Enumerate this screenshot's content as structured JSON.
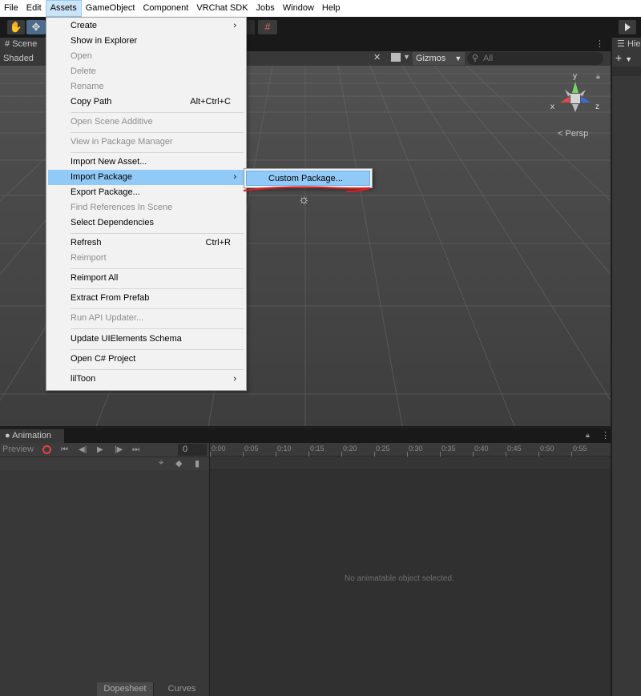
{
  "menubar": {
    "items": [
      "File",
      "Edit",
      "Assets",
      "GameObject",
      "Component",
      "VRChat SDK",
      "Jobs",
      "Window",
      "Help"
    ],
    "active_index": 2
  },
  "scene": {
    "tab_label": "Scene",
    "shading_mode": "Shaded",
    "gizmos_label": "Gizmos",
    "search_placeholder": "All",
    "persp_label": "< Persp",
    "axis_labels": {
      "y": "y",
      "x": "x",
      "z": "z"
    }
  },
  "hierarchy": {
    "tab_label": "Hie",
    "add_label": "+"
  },
  "assets_menu": {
    "items": [
      {
        "label": "Create",
        "shortcut": "",
        "disabled": false,
        "submenu": true
      },
      {
        "label": "Show in Explorer",
        "shortcut": "",
        "disabled": false,
        "submenu": false
      },
      {
        "label": "Open",
        "shortcut": "",
        "disabled": true,
        "submenu": false
      },
      {
        "label": "Delete",
        "shortcut": "",
        "disabled": true,
        "submenu": false
      },
      {
        "label": "Rename",
        "shortcut": "",
        "disabled": true,
        "submenu": false
      },
      {
        "label": "Copy Path",
        "shortcut": "Alt+Ctrl+C",
        "disabled": false,
        "submenu": false
      },
      {
        "label": "Open Scene Additive",
        "shortcut": "",
        "disabled": true,
        "submenu": false
      },
      {
        "label": "View in Package Manager",
        "shortcut": "",
        "disabled": true,
        "submenu": false
      },
      {
        "label": "Import New Asset...",
        "shortcut": "",
        "disabled": false,
        "submenu": false
      },
      {
        "label": "Import Package",
        "shortcut": "",
        "disabled": false,
        "submenu": true,
        "highlighted": true
      },
      {
        "label": "Export Package...",
        "shortcut": "",
        "disabled": false,
        "submenu": false
      },
      {
        "label": "Find References In Scene",
        "shortcut": "",
        "disabled": true,
        "submenu": false
      },
      {
        "label": "Select Dependencies",
        "shortcut": "",
        "disabled": false,
        "submenu": false
      },
      {
        "label": "Refresh",
        "shortcut": "Ctrl+R",
        "disabled": false,
        "submenu": false
      },
      {
        "label": "Reimport",
        "shortcut": "",
        "disabled": true,
        "submenu": false
      },
      {
        "label": "Reimport All",
        "shortcut": "",
        "disabled": false,
        "submenu": false
      },
      {
        "label": "Extract From Prefab",
        "shortcut": "",
        "disabled": false,
        "submenu": false
      },
      {
        "label": "Run API Updater...",
        "shortcut": "",
        "disabled": true,
        "submenu": false
      },
      {
        "label": "Update UIElements Schema",
        "shortcut": "",
        "disabled": false,
        "submenu": false
      },
      {
        "label": "Open C# Project",
        "shortcut": "",
        "disabled": false,
        "submenu": false
      },
      {
        "label": "lilToon",
        "shortcut": "",
        "disabled": false,
        "submenu": true
      }
    ],
    "submenu_arrow": "›"
  },
  "import_package_submenu": {
    "items": [
      {
        "label": "Custom Package...",
        "highlighted": true
      }
    ]
  },
  "annotation": {
    "color": "#d42020"
  },
  "animation": {
    "tab_label": "Animation",
    "preview_label": "Preview",
    "frame_value": "0",
    "timeline_ticks": [
      "0:00",
      "0:05",
      "0:10",
      "0:15",
      "0:20",
      "0:25",
      "0:30",
      "0:35",
      "0:40",
      "0:45",
      "0:50",
      "0:55"
    ],
    "empty_message": "No animatable object selected.",
    "bottom_tabs": [
      "Dopesheet",
      "Curves"
    ],
    "selected_bottom_tab": "Dopesheet"
  }
}
